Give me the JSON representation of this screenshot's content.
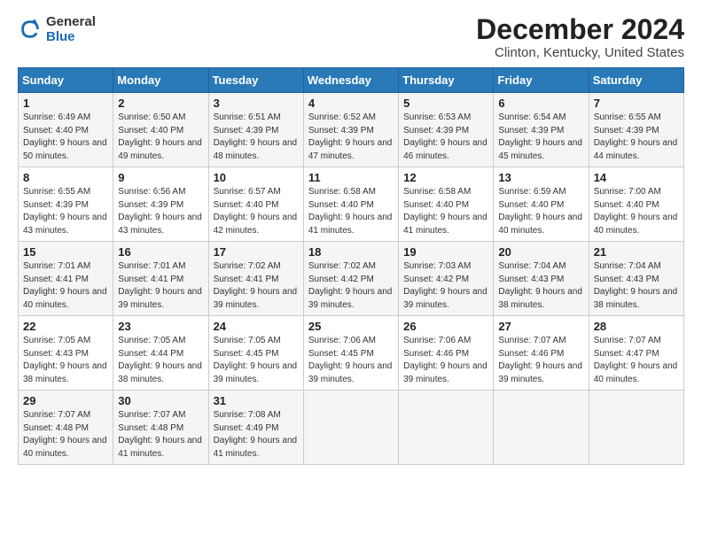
{
  "logo": {
    "line1": "General",
    "line2": "Blue"
  },
  "title": "December 2024",
  "location": "Clinton, Kentucky, United States",
  "days_header": [
    "Sunday",
    "Monday",
    "Tuesday",
    "Wednesday",
    "Thursday",
    "Friday",
    "Saturday"
  ],
  "weeks": [
    [
      {
        "day": "1",
        "sunrise": "6:49 AM",
        "sunset": "4:40 PM",
        "daylight": "9 hours and 50 minutes."
      },
      {
        "day": "2",
        "sunrise": "6:50 AM",
        "sunset": "4:40 PM",
        "daylight": "9 hours and 49 minutes."
      },
      {
        "day": "3",
        "sunrise": "6:51 AM",
        "sunset": "4:39 PM",
        "daylight": "9 hours and 48 minutes."
      },
      {
        "day": "4",
        "sunrise": "6:52 AM",
        "sunset": "4:39 PM",
        "daylight": "9 hours and 47 minutes."
      },
      {
        "day": "5",
        "sunrise": "6:53 AM",
        "sunset": "4:39 PM",
        "daylight": "9 hours and 46 minutes."
      },
      {
        "day": "6",
        "sunrise": "6:54 AM",
        "sunset": "4:39 PM",
        "daylight": "9 hours and 45 minutes."
      },
      {
        "day": "7",
        "sunrise": "6:55 AM",
        "sunset": "4:39 PM",
        "daylight": "9 hours and 44 minutes."
      }
    ],
    [
      {
        "day": "8",
        "sunrise": "6:55 AM",
        "sunset": "4:39 PM",
        "daylight": "9 hours and 43 minutes."
      },
      {
        "day": "9",
        "sunrise": "6:56 AM",
        "sunset": "4:39 PM",
        "daylight": "9 hours and 43 minutes."
      },
      {
        "day": "10",
        "sunrise": "6:57 AM",
        "sunset": "4:40 PM",
        "daylight": "9 hours and 42 minutes."
      },
      {
        "day": "11",
        "sunrise": "6:58 AM",
        "sunset": "4:40 PM",
        "daylight": "9 hours and 41 minutes."
      },
      {
        "day": "12",
        "sunrise": "6:58 AM",
        "sunset": "4:40 PM",
        "daylight": "9 hours and 41 minutes."
      },
      {
        "day": "13",
        "sunrise": "6:59 AM",
        "sunset": "4:40 PM",
        "daylight": "9 hours and 40 minutes."
      },
      {
        "day": "14",
        "sunrise": "7:00 AM",
        "sunset": "4:40 PM",
        "daylight": "9 hours and 40 minutes."
      }
    ],
    [
      {
        "day": "15",
        "sunrise": "7:01 AM",
        "sunset": "4:41 PM",
        "daylight": "9 hours and 40 minutes."
      },
      {
        "day": "16",
        "sunrise": "7:01 AM",
        "sunset": "4:41 PM",
        "daylight": "9 hours and 39 minutes."
      },
      {
        "day": "17",
        "sunrise": "7:02 AM",
        "sunset": "4:41 PM",
        "daylight": "9 hours and 39 minutes."
      },
      {
        "day": "18",
        "sunrise": "7:02 AM",
        "sunset": "4:42 PM",
        "daylight": "9 hours and 39 minutes."
      },
      {
        "day": "19",
        "sunrise": "7:03 AM",
        "sunset": "4:42 PM",
        "daylight": "9 hours and 39 minutes."
      },
      {
        "day": "20",
        "sunrise": "7:04 AM",
        "sunset": "4:43 PM",
        "daylight": "9 hours and 38 minutes."
      },
      {
        "day": "21",
        "sunrise": "7:04 AM",
        "sunset": "4:43 PM",
        "daylight": "9 hours and 38 minutes."
      }
    ],
    [
      {
        "day": "22",
        "sunrise": "7:05 AM",
        "sunset": "4:43 PM",
        "daylight": "9 hours and 38 minutes."
      },
      {
        "day": "23",
        "sunrise": "7:05 AM",
        "sunset": "4:44 PM",
        "daylight": "9 hours and 38 minutes."
      },
      {
        "day": "24",
        "sunrise": "7:05 AM",
        "sunset": "4:45 PM",
        "daylight": "9 hours and 39 minutes."
      },
      {
        "day": "25",
        "sunrise": "7:06 AM",
        "sunset": "4:45 PM",
        "daylight": "9 hours and 39 minutes."
      },
      {
        "day": "26",
        "sunrise": "7:06 AM",
        "sunset": "4:46 PM",
        "daylight": "9 hours and 39 minutes."
      },
      {
        "day": "27",
        "sunrise": "7:07 AM",
        "sunset": "4:46 PM",
        "daylight": "9 hours and 39 minutes."
      },
      {
        "day": "28",
        "sunrise": "7:07 AM",
        "sunset": "4:47 PM",
        "daylight": "9 hours and 40 minutes."
      }
    ],
    [
      {
        "day": "29",
        "sunrise": "7:07 AM",
        "sunset": "4:48 PM",
        "daylight": "9 hours and 40 minutes."
      },
      {
        "day": "30",
        "sunrise": "7:07 AM",
        "sunset": "4:48 PM",
        "daylight": "9 hours and 41 minutes."
      },
      {
        "day": "31",
        "sunrise": "7:08 AM",
        "sunset": "4:49 PM",
        "daylight": "9 hours and 41 minutes."
      },
      null,
      null,
      null,
      null
    ]
  ]
}
